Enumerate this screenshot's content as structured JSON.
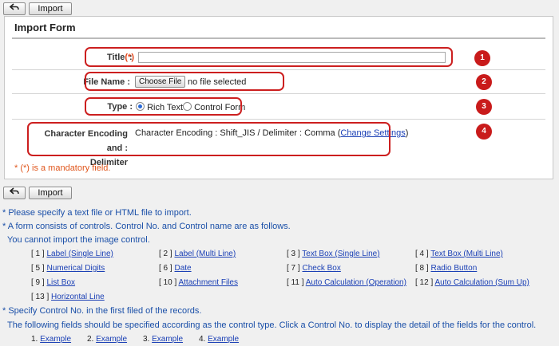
{
  "toolbar": {
    "back_icon": "back-arrow-icon",
    "import_label": "Import"
  },
  "form": {
    "title": "Import Form",
    "fields": {
      "title_label": "Title",
      "title_req": "(*)",
      "title_colon": ":",
      "filename_label": "File Name :",
      "choose_file": "Choose File",
      "no_file": "no file selected",
      "type_label": "Type :",
      "type_rich": "Rich Text",
      "type_control": "Control Form",
      "encoding_label_1": "Character Encoding and :",
      "encoding_label_2": "Delimiter",
      "encoding_value": "Character Encoding : Shift_JIS / Delimiter : Comma (",
      "change_settings": "Change Settings",
      "encoding_close": ")"
    },
    "mandatory_note": "* (*) is a mandatory field.",
    "markers": [
      "1",
      "2",
      "3",
      "4"
    ]
  },
  "notes": {
    "line1": "* Please specify a text file or HTML file to import.",
    "line2": "* A form consists of controls. Control No. and Control name are as follows.",
    "line3": "You cannot import the image control.",
    "line4": "* Specify Control No. in the first filed of the records.",
    "line5": "The following fields should be specified according as the control type. Click a Control No. to display the detail of the fields for the control."
  },
  "controls": [
    {
      "no": "[ 1 ]",
      "name": "Label (Single Line)"
    },
    {
      "no": "[ 2 ]",
      "name": "Label (Multi Line)"
    },
    {
      "no": "[ 3 ]",
      "name": "Text Box (Single Line)"
    },
    {
      "no": "[ 4 ]",
      "name": "Text Box (Multi Line)"
    },
    {
      "no": "[ 5 ]",
      "name": "Numerical Digits"
    },
    {
      "no": "[ 6 ]",
      "name": "Date"
    },
    {
      "no": "[ 7 ]",
      "name": "Check Box"
    },
    {
      "no": "[ 8 ]",
      "name": "Radio Button"
    },
    {
      "no": "[ 9 ]",
      "name": "List Box"
    },
    {
      "no": "[ 10 ]",
      "name": "Attachment Files"
    },
    {
      "no": "[ 11 ]",
      "name": "Auto Calculation (Operation)"
    },
    {
      "no": "[ 12 ]",
      "name": "Auto Calculation (Sum Up)"
    },
    {
      "no": "[ 13 ]",
      "name": "Horizontal Line"
    }
  ],
  "examples": [
    {
      "no": "1.",
      "label": "Example"
    },
    {
      "no": "2.",
      "label": "Example"
    },
    {
      "no": "3.",
      "label": "Example"
    },
    {
      "no": "4.",
      "label": "Example"
    }
  ],
  "colors": {
    "callout": "#cc1f1f",
    "link": "#1a3fb5",
    "note": "#1a4fa8",
    "mandatory": "#e0561c"
  }
}
